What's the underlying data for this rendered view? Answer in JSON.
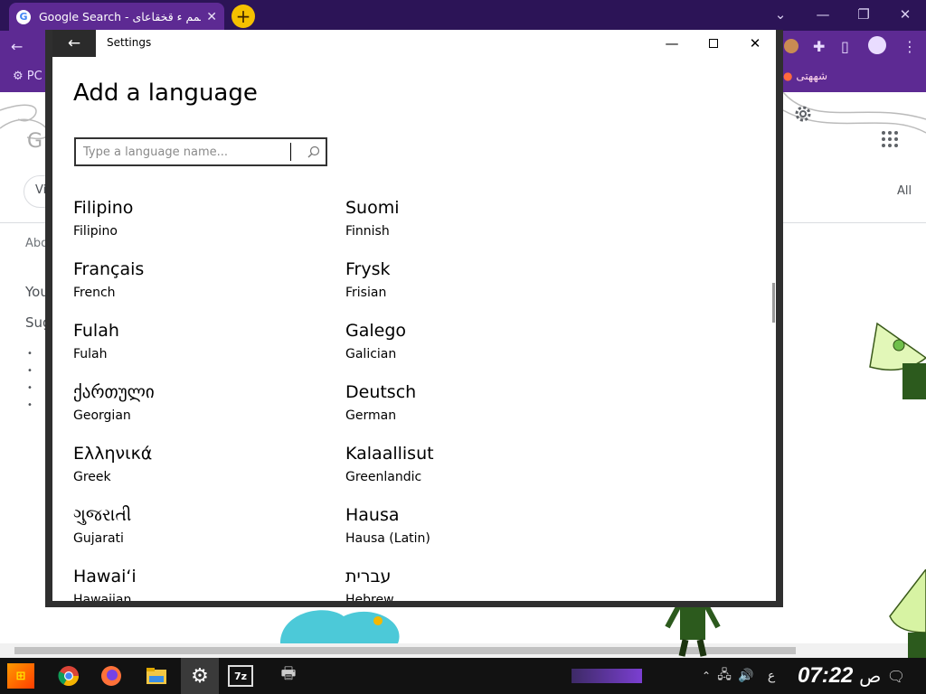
{
  "browser": {
    "tab_title": "Google Search - عمم ء قخقاعاى",
    "bookmark_right": "شههتى",
    "bookmark_left": "PC",
    "page_fragments": {
      "vi": "Vi",
      "all": "All",
      "abo": "Abo",
      "you": "You",
      "sug": "Sug"
    }
  },
  "settings": {
    "window_title": "Settings",
    "heading": "Add a language",
    "search": {
      "placeholder": "Type a language name..."
    },
    "languages": [
      {
        "native": "Filipino",
        "english": "Filipino"
      },
      {
        "native": "Suomi",
        "english": "Finnish"
      },
      {
        "native": "Français",
        "english": "French"
      },
      {
        "native": "Frysk",
        "english": "Frisian"
      },
      {
        "native": "Fulah",
        "english": "Fulah"
      },
      {
        "native": "Galego",
        "english": "Galician"
      },
      {
        "native": "ქართული",
        "english": "Georgian"
      },
      {
        "native": "Deutsch",
        "english": "German"
      },
      {
        "native": "Ελληνικά",
        "english": "Greek"
      },
      {
        "native": "Kalaallisut",
        "english": "Greenlandic"
      },
      {
        "native": "ગુજરાતી",
        "english": "Gujarati"
      },
      {
        "native": "Hausa",
        "english": "Hausa (Latin)"
      },
      {
        "native": "Hawaiʻi",
        "english": "Hawaiian"
      },
      {
        "native": "עברית",
        "english": "Hebrew"
      }
    ]
  },
  "taskbar": {
    "clock": "07:22",
    "ampm": "ص",
    "lang_indicator": "ع",
    "app_7z": "7z"
  },
  "colors": {
    "chrome_theme": "#5d2a93",
    "tabstrip": "#2c1457",
    "new_tab_button": "#f5c000",
    "taskbar": "#121212"
  },
  "icons": [
    "google-g-icon",
    "plus-icon",
    "back-arrow-icon",
    "minimize-icon",
    "maximize-icon",
    "close-icon",
    "search-icon",
    "gear-icon",
    "apps-grid-icon",
    "chrome-icon",
    "firefox-icon",
    "folder-icon",
    "settings-icon",
    "printer-icon",
    "volume-icon",
    "network-icon",
    "notification-icon"
  ]
}
